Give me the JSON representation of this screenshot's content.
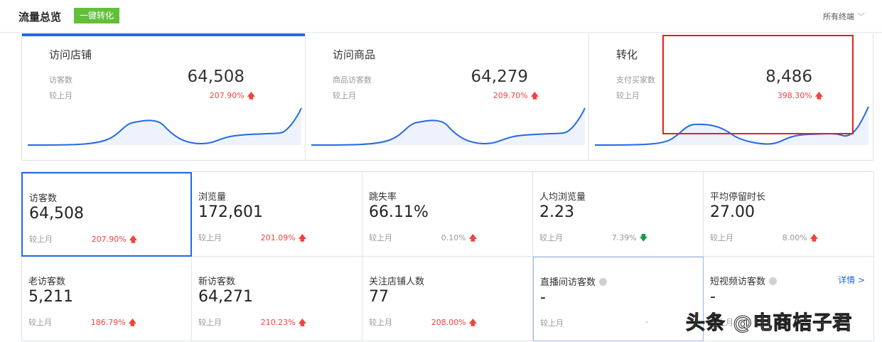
{
  "header": {
    "title": "流量总览",
    "convert_button": "一键转化",
    "terminal_select": "所有终端"
  },
  "cards": [
    {
      "title": "访问店铺",
      "label": "访客数",
      "value": "64,508",
      "compare_label": "较上月",
      "change": "207.90%",
      "trend": "up"
    },
    {
      "title": "访问商品",
      "label": "商品访客数",
      "value": "64,279",
      "compare_label": "较上月",
      "change": "209.70%",
      "trend": "up"
    },
    {
      "title": "转化",
      "label": "支付买家数",
      "value": "8,486",
      "compare_label": "较上月",
      "change": "398.30%",
      "trend": "up"
    }
  ],
  "metrics": [
    {
      "label": "访客数",
      "value": "64,508",
      "compare_label": "较上月",
      "change": "207.90%",
      "trend": "up"
    },
    {
      "label": "浏览量",
      "value": "172,601",
      "compare_label": "较上月",
      "change": "201.09%",
      "trend": "up"
    },
    {
      "label": "跳失率",
      "value": "66.11%",
      "compare_label": "较上月",
      "change": "0.10%",
      "trend": "up"
    },
    {
      "label": "人均浏览量",
      "value": "2.23",
      "compare_label": "较上月",
      "change": "7.39%",
      "trend": "down"
    },
    {
      "label": "平均停留时长",
      "value": "27.00",
      "compare_label": "较上月",
      "change": "8.00%",
      "trend": "up"
    },
    {
      "label": "老访客数",
      "value": "5,211",
      "compare_label": "较上月",
      "change": "186.79%",
      "trend": "up"
    },
    {
      "label": "新访客数",
      "value": "64,271",
      "compare_label": "较上月",
      "change": "210.23%",
      "trend": "up"
    },
    {
      "label": "关注店铺人数",
      "value": "77",
      "compare_label": "较上月",
      "change": "208.00%",
      "trend": "up"
    },
    {
      "label": "直播间访客数",
      "value": "-",
      "compare_label": "较上月",
      "change": "-",
      "trend": "none"
    },
    {
      "label": "短视频访客数",
      "value": "-",
      "compare_label": "较上月",
      "change": "",
      "trend": "none",
      "link": "详情 >"
    }
  ],
  "colors": {
    "accent": "#2468e6",
    "up": "#f0443e",
    "down": "#1a9a49",
    "button": "#62bf3a",
    "annotation": "#e8201c"
  },
  "watermark": "头条 @电商桔子君"
}
